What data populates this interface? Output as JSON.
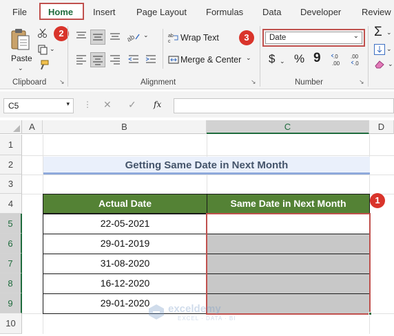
{
  "menu": {
    "tabs": [
      "File",
      "Home",
      "Insert",
      "Page Layout",
      "Formulas",
      "Data",
      "Developer",
      "Review"
    ],
    "active_tab": "Home"
  },
  "ribbon": {
    "clipboard": {
      "paste_label": "Paste",
      "group_label": "Clipboard"
    },
    "alignment": {
      "wrap_text_label": "Wrap Text",
      "merge_center_label": "Merge & Center",
      "group_label": "Alignment"
    },
    "number": {
      "format_value": "Date",
      "group_label": "Number",
      "currency_symbol": "$",
      "percent_symbol": "%",
      "comma_symbol": "9",
      "inc_decimal": "←.0\n.00",
      "dec_decimal": ".00\n→.0"
    }
  },
  "badges": {
    "home": "2",
    "number_format": "3",
    "selection": "1"
  },
  "formula_bar": {
    "name_box": "C5",
    "fx": "fx",
    "cancel": "✕",
    "enter": "✓",
    "formula": ""
  },
  "sheet": {
    "columns": [
      "A",
      "B",
      "C",
      "D"
    ],
    "rows": [
      "1",
      "2",
      "3",
      "4",
      "5",
      "6",
      "7",
      "8",
      "9",
      "10"
    ],
    "title": "Getting Same Date in Next Month",
    "table": {
      "headers": [
        "Actual Date",
        "Same Date in Next Month"
      ],
      "dates": [
        "22-05-2021",
        "29-01-2019",
        "31-08-2020",
        "16-12-2020",
        "29-01-2020"
      ]
    }
  },
  "watermark": {
    "name": "exceldemy",
    "tagline": "EXCEL · DATA · BI"
  },
  "colors": {
    "header_green": "#548235",
    "excel_green": "#1e6b3c",
    "badge_red": "#d9342b",
    "highlight_border": "#c0504d",
    "title_underline": "#8ea9db"
  }
}
